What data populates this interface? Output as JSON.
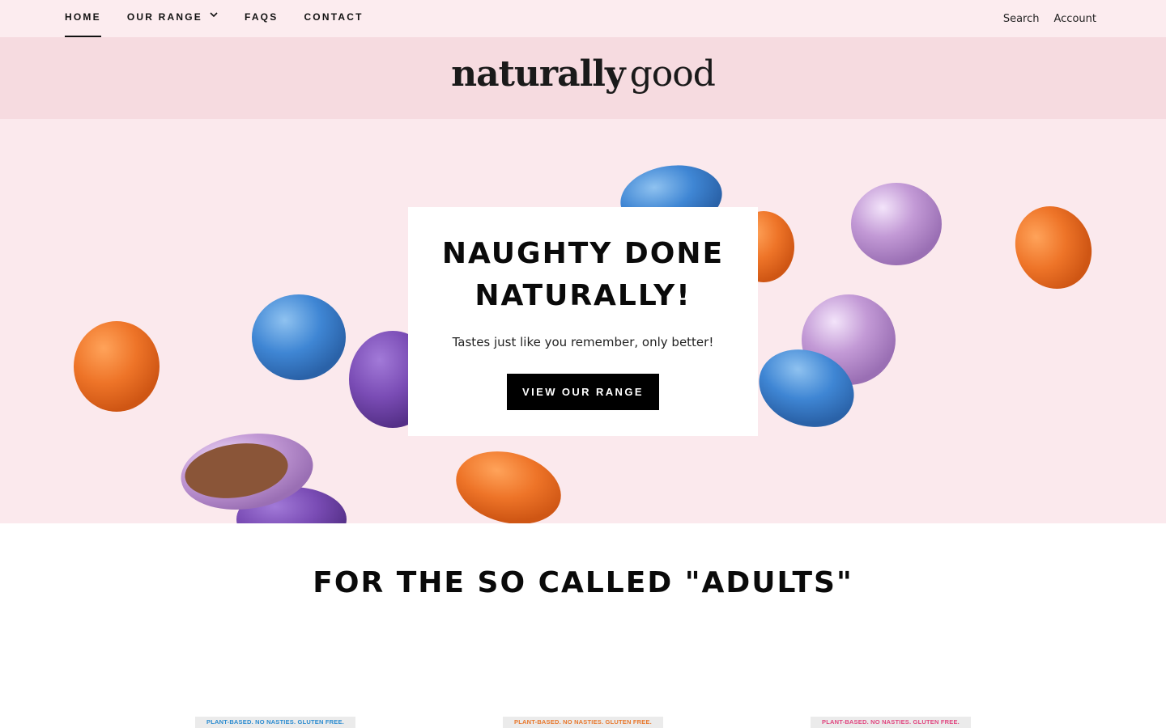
{
  "nav": {
    "items": [
      {
        "label": "HOME",
        "active": true
      },
      {
        "label": "OUR RANGE",
        "has_dropdown": true
      },
      {
        "label": "FAQS"
      },
      {
        "label": "CONTACT"
      }
    ],
    "search_label": "Search",
    "account_label": "Account"
  },
  "logo": {
    "bold": "naturally",
    "light": "good"
  },
  "hero": {
    "title_line1": "NAUGHTY DONE",
    "title_line2": "NATURALLY!",
    "subtitle": "Tastes just like you remember, only better!",
    "button_label": "VIEW OUR RANGE"
  },
  "section": {
    "title": "FOR THE SO CALLED \"ADULTS\""
  },
  "products": [
    {
      "strip_text": "PLANT-BASED.  NO NASTIES.  GLUTEN FREE.",
      "color": "#2a8bd0"
    },
    {
      "strip_text": "PLANT-BASED.  NO NASTIES.  GLUTEN FREE.",
      "color": "#e8762a"
    },
    {
      "strip_text": "PLANT-BASED.  NO NASTIES.  GLUTEN FREE.",
      "color": "#e0457f"
    }
  ],
  "colors": {
    "topbar_bg": "#fcecef",
    "logoband_bg": "#f6dbe0",
    "hero_bg": "#fbe9ed",
    "candy_blue": "#3f86d4",
    "candy_orange": "#ee7428",
    "candy_purple": "#7a4cb5",
    "candy_lilac": "#c39ad6"
  }
}
